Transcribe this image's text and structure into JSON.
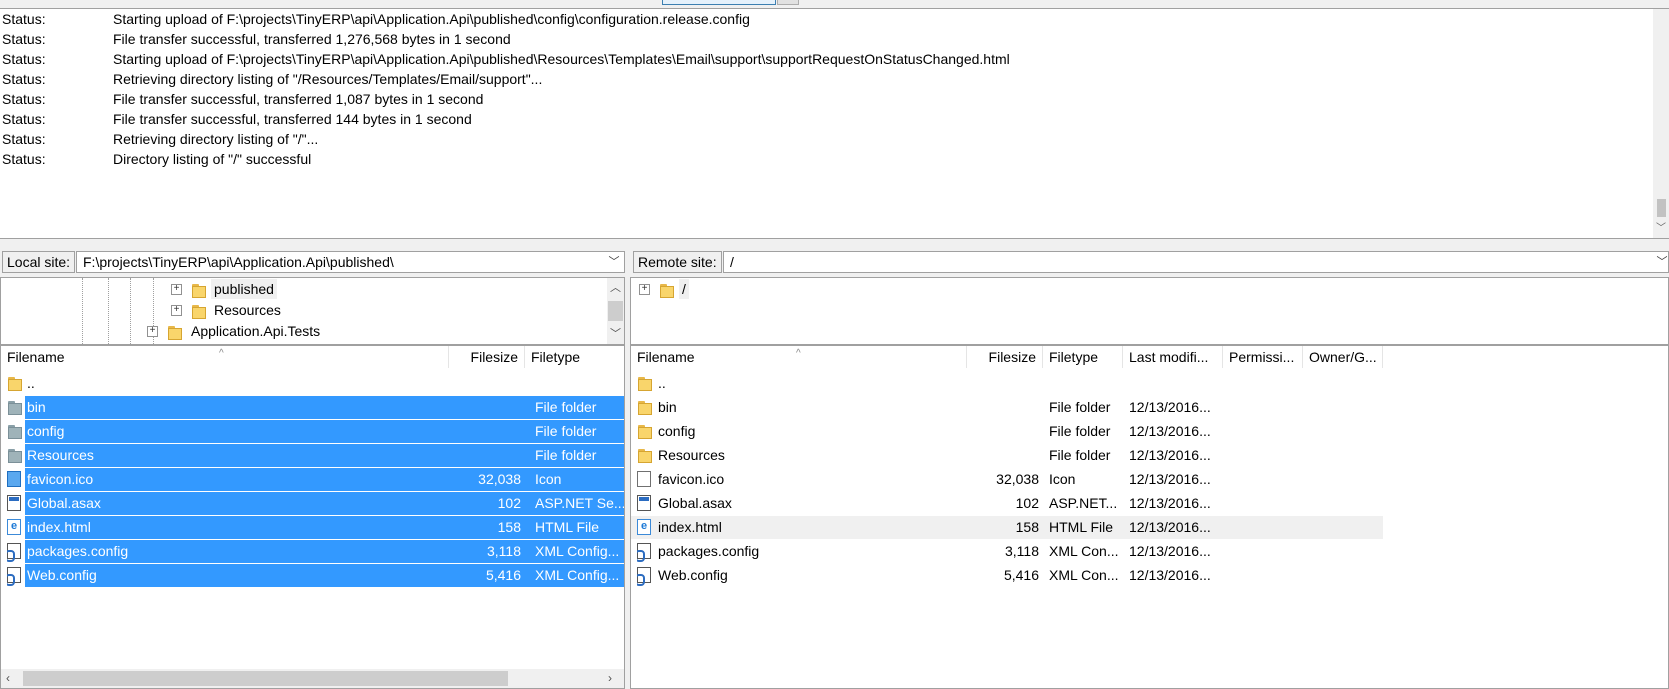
{
  "log": {
    "label": "Status:",
    "messages": [
      "Starting upload of F:\\projects\\TinyERP\\api\\Application.Api\\published\\config\\configuration.release.config",
      "File transfer successful, transferred 1,276,568 bytes in 1 second",
      "Starting upload of F:\\projects\\TinyERP\\api\\Application.Api\\published\\Resources\\Templates\\Email\\support\\supportRequestOnStatusChanged.html",
      "Retrieving directory listing of \"/Resources/Templates/Email/support\"...",
      "File transfer successful, transferred 1,087 bytes in 1 second",
      "File transfer successful, transferred 144 bytes in 1 second",
      "Retrieving directory listing of \"/\"...",
      "Directory listing of \"/\" successful"
    ]
  },
  "local": {
    "site_label": "Local site:",
    "path": "F:\\projects\\TinyERP\\api\\Application.Api\\published\\",
    "tree": [
      "published",
      "Resources",
      "Application.Api.Tests"
    ],
    "columns": [
      "Filename",
      "Filesize",
      "Filetype"
    ],
    "files": [
      {
        "name": "..",
        "size": "",
        "type": "",
        "icon": "folder-icon",
        "selected": false
      },
      {
        "name": "bin",
        "size": "",
        "type": "File folder",
        "icon": "folder-icon",
        "selected": true
      },
      {
        "name": "config",
        "size": "",
        "type": "File folder",
        "icon": "folder-icon",
        "selected": true
      },
      {
        "name": "Resources",
        "size": "",
        "type": "File folder",
        "icon": "folder-icon",
        "selected": true
      },
      {
        "name": "favicon.ico",
        "size": "32,038",
        "type": "Icon",
        "icon": "file-icon",
        "selected": true
      },
      {
        "name": "Global.asax",
        "size": "102",
        "type": "ASP.NET Se...",
        "icon": "asax-file-icon",
        "selected": true
      },
      {
        "name": "index.html",
        "size": "158",
        "type": "HTML File",
        "icon": "html-file-icon",
        "selected": true
      },
      {
        "name": "packages.config",
        "size": "3,118",
        "type": "XML Config...",
        "icon": "xml-config-icon",
        "selected": true
      },
      {
        "name": "Web.config",
        "size": "5,416",
        "type": "XML Config...",
        "icon": "xml-config-icon",
        "selected": true
      }
    ]
  },
  "remote": {
    "site_label": "Remote site:",
    "path": "/",
    "tree": [
      "/"
    ],
    "columns": [
      "Filename",
      "Filesize",
      "Filetype",
      "Last modifi...",
      "Permissi...",
      "Owner/G..."
    ],
    "files": [
      {
        "name": "..",
        "size": "",
        "type": "",
        "modified": "",
        "icon": "folder-icon"
      },
      {
        "name": "bin",
        "size": "",
        "type": "File folder",
        "modified": "12/13/2016...",
        "icon": "folder-icon"
      },
      {
        "name": "config",
        "size": "",
        "type": "File folder",
        "modified": "12/13/2016...",
        "icon": "folder-icon"
      },
      {
        "name": "Resources",
        "size": "",
        "type": "File folder",
        "modified": "12/13/2016...",
        "icon": "folder-icon"
      },
      {
        "name": "favicon.ico",
        "size": "32,038",
        "type": "Icon",
        "modified": "12/13/2016...",
        "icon": "file-icon"
      },
      {
        "name": "Global.asax",
        "size": "102",
        "type": "ASP.NET...",
        "modified": "12/13/2016...",
        "icon": "asax-file-icon"
      },
      {
        "name": "index.html",
        "size": "158",
        "type": "HTML File",
        "modified": "12/13/2016...",
        "icon": "html-file-icon"
      },
      {
        "name": "packages.config",
        "size": "3,118",
        "type": "XML Con...",
        "modified": "12/13/2016...",
        "icon": "xml-config-icon"
      },
      {
        "name": "Web.config",
        "size": "5,416",
        "type": "XML Con...",
        "modified": "12/13/2016...",
        "icon": "xml-config-icon"
      }
    ]
  },
  "colors": {
    "selection": "#3399ff",
    "hover": "#f0f0f0",
    "folder": "#f9d56b"
  }
}
